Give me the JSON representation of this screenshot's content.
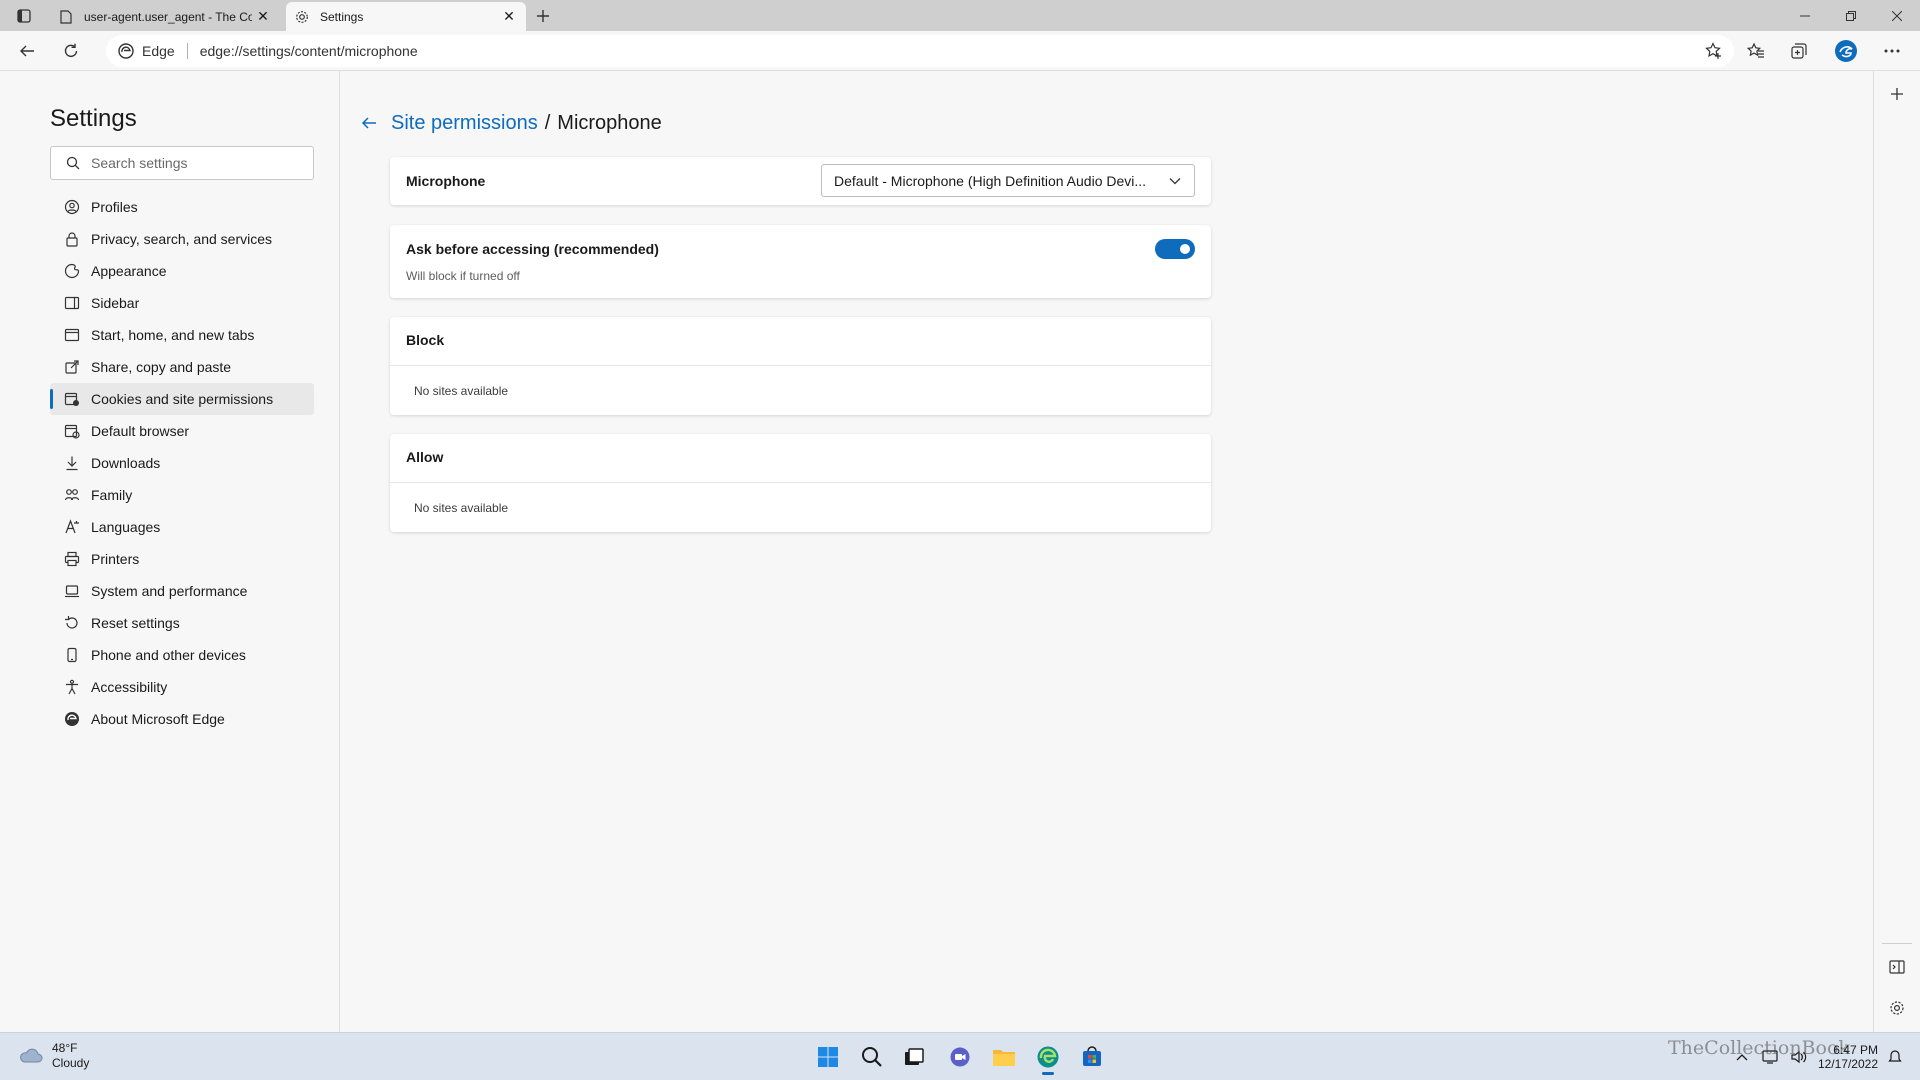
{
  "browser": {
    "tabs": [
      {
        "title": "user-agent.user_agent - The Coll",
        "active": false
      },
      {
        "title": "Settings",
        "active": true
      }
    ],
    "address": {
      "badge": "Edge",
      "url": "edge://settings/content/microphone"
    },
    "accent": "#0f6cbd"
  },
  "sidebar": {
    "title": "Settings",
    "search_placeholder": "Search settings",
    "items": [
      {
        "label": "Profiles",
        "icon": "profile-icon"
      },
      {
        "label": "Privacy, search, and services",
        "icon": "lock-icon"
      },
      {
        "label": "Appearance",
        "icon": "appearance-icon"
      },
      {
        "label": "Sidebar",
        "icon": "sidebar-icon"
      },
      {
        "label": "Start, home, and new tabs",
        "icon": "home-icon"
      },
      {
        "label": "Share, copy and paste",
        "icon": "share-icon"
      },
      {
        "label": "Cookies and site permissions",
        "icon": "cookies-icon",
        "active": true
      },
      {
        "label": "Default browser",
        "icon": "browser-icon"
      },
      {
        "label": "Downloads",
        "icon": "download-icon"
      },
      {
        "label": "Family",
        "icon": "family-icon"
      },
      {
        "label": "Languages",
        "icon": "languages-icon"
      },
      {
        "label": "Printers",
        "icon": "printer-icon"
      },
      {
        "label": "System and performance",
        "icon": "laptop-icon"
      },
      {
        "label": "Reset settings",
        "icon": "reset-icon"
      },
      {
        "label": "Phone and other devices",
        "icon": "phone-icon"
      },
      {
        "label": "Accessibility",
        "icon": "accessibility-icon"
      },
      {
        "label": "About Microsoft Edge",
        "icon": "edge-icon"
      }
    ]
  },
  "main": {
    "breadcrumb": {
      "parent": "Site permissions",
      "separator": "/",
      "current": "Microphone"
    },
    "microphone": {
      "label": "Microphone",
      "selected_device": "Default - Microphone (High Definition Audio Devi..."
    },
    "ask": {
      "label": "Ask before accessing (recommended)",
      "sub": "Will block if turned off",
      "enabled": true
    },
    "block": {
      "heading": "Block",
      "empty": "No sites available"
    },
    "allow": {
      "heading": "Allow",
      "empty": "No sites available"
    }
  },
  "taskbar": {
    "weather": {
      "temp": "48°F",
      "condition": "Cloudy"
    },
    "clock": {
      "time": "6:47 PM",
      "date": "12/17/2022"
    },
    "watermark": "TheCollectionBook"
  }
}
